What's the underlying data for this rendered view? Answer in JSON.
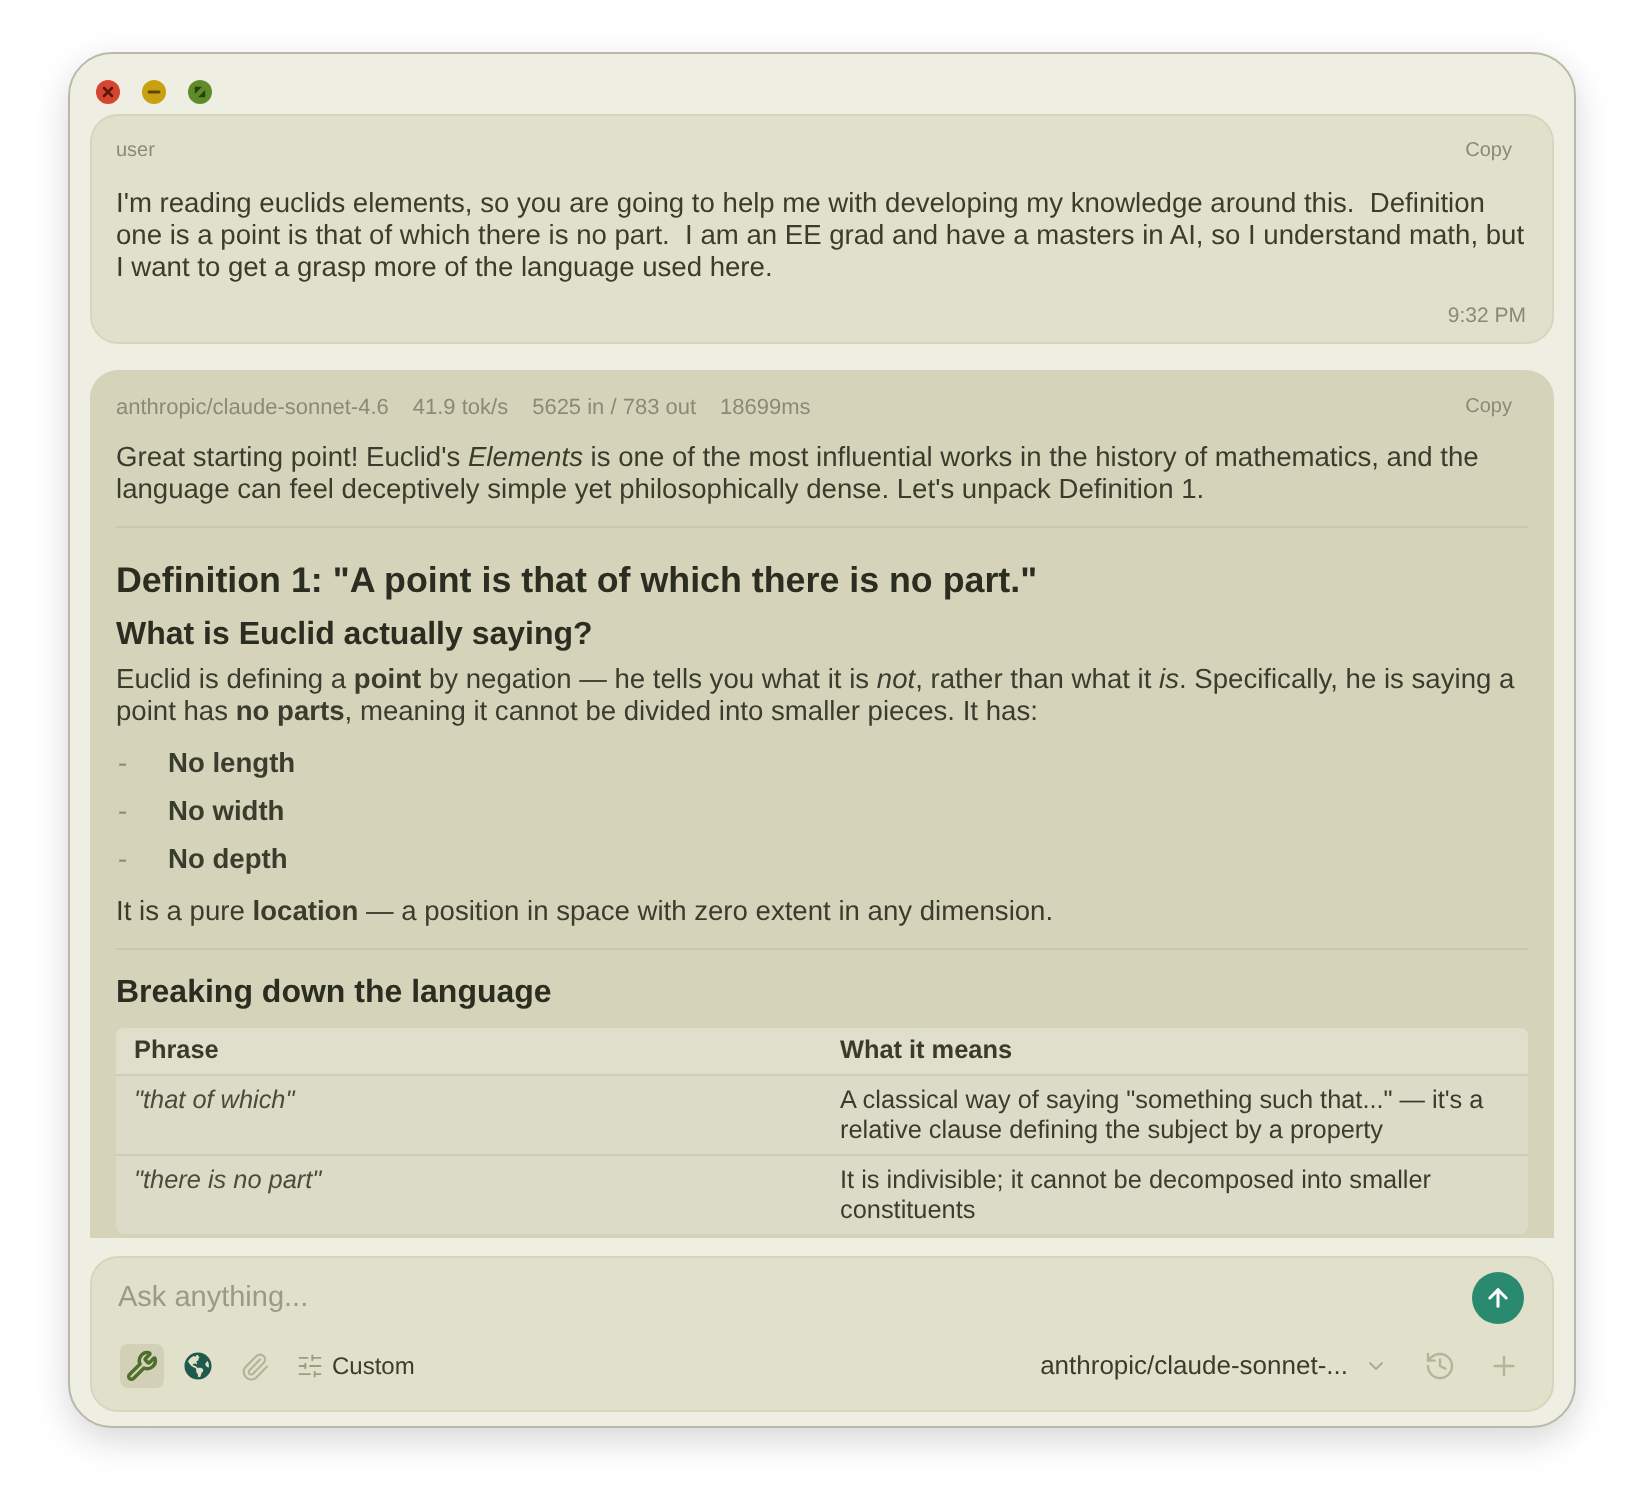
{
  "window_controls": [
    {
      "kind": "close"
    },
    {
      "kind": "minimize"
    },
    {
      "kind": "zoom"
    }
  ],
  "messages": [
    {
      "kind": "user",
      "sender": "user",
      "copy": "Copy",
      "blocks": [
        {
          "kind": "paragraph",
          "text": "I'm reading euclids elements, so you are going to help me with developing my knowledge around this.  Definition one is a point is that of which there is no part.  I am an EE grad and have a masters in AI, so I understand math, but I want to get a grasp more of the language used here."
        }
      ],
      "time": "9:32 PM"
    },
    {
      "kind": "assistant",
      "meta": [
        "anthropic/claude-sonnet-4.6",
        "41.9 tok/s",
        "5625 in / 783 out",
        "18699ms"
      ],
      "copy": "Copy",
      "blocks": [
        {
          "kind": "paragraph",
          "text": "Great starting point! Euclid's *Elements* is one of the most influential works in the history of mathematics, and the language can feel deceptively simple yet philosophically dense. Let's unpack Definition 1."
        },
        {
          "kind": "divider"
        },
        {
          "kind": "heading1",
          "text": "Definition 1: \"A point is that of which there is no part.\""
        },
        {
          "kind": "heading2",
          "text": "What is Euclid actually saying?"
        },
        {
          "kind": "paragraph",
          "text": "Euclid is defining a **point** by negation — he tells you what it is *not*, rather than what it *is*. Specifically, he is saying a point has **no parts**, meaning it cannot be divided into smaller pieces. It has:"
        },
        {
          "kind": "list",
          "items": [
            {
              "marker": "-",
              "text": "No length"
            },
            {
              "marker": "-",
              "text": "No width"
            },
            {
              "marker": "-",
              "text": "No depth"
            }
          ]
        },
        {
          "kind": "paragraph",
          "text": "It is a pure **location** — a position in space with zero extent in any dimension."
        },
        {
          "kind": "divider"
        },
        {
          "kind": "heading2",
          "text": "Breaking down the language"
        },
        {
          "kind": "table",
          "columns": [
            "Phrase",
            "What it means"
          ],
          "rows": [
            [
              "\"that of which\"",
              "A classical way of saying \"something such that...\" — it's a relative clause defining the subject by a property"
            ],
            [
              "\"there is no part\"",
              "It is indivisible; it cannot be decomposed into smaller constituents"
            ]
          ]
        }
      ]
    }
  ],
  "composer": {
    "placeholder": "Ask anything...",
    "tools": [
      {
        "kind": "wrench",
        "selected": true,
        "on": true
      },
      {
        "kind": "globe",
        "selected": false,
        "on": true
      },
      {
        "kind": "paperclip",
        "selected": false,
        "on": false
      }
    ],
    "mode": {
      "label": "Custom"
    },
    "model": {
      "value": "anthropic/claude-sonnet-..."
    }
  }
}
